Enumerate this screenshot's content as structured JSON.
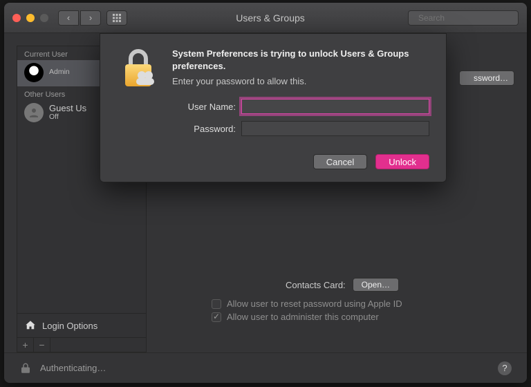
{
  "window": {
    "title": "Users & Groups",
    "search_placeholder": "Search"
  },
  "sidebar": {
    "current_label": "Current User",
    "current_role": "Admin",
    "other_label": "Other Users",
    "guest_name": "Guest Us",
    "guest_status": "Off",
    "login_options": "Login Options"
  },
  "panel": {
    "change_password_btn": "ssword…",
    "contacts_label": "Contacts Card:",
    "open_btn": "Open…",
    "reset_label": "Allow user to reset password using Apple ID",
    "admin_label": "Allow user to administer this computer"
  },
  "footer": {
    "status": "Authenticating…",
    "help": "?"
  },
  "dialog": {
    "title": "System Preferences is trying to unlock Users & Groups preferences.",
    "subtitle": "Enter your password to allow this.",
    "username_label": "User Name:",
    "password_label": "Password:",
    "username_value": "",
    "password_value": "",
    "cancel": "Cancel",
    "unlock": "Unlock"
  }
}
